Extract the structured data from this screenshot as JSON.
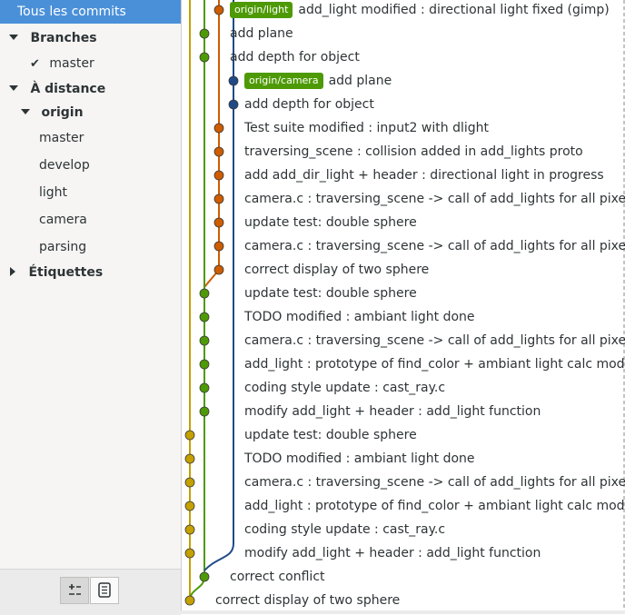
{
  "sidebar": {
    "all_commits": "Tous les commits",
    "branches_header": "Branches",
    "local_branch": "master",
    "remote_header": "À distance",
    "remote_name": "origin",
    "remote_branches": [
      "master",
      "develop",
      "light",
      "camera",
      "parsing"
    ],
    "tags_header": "Étiquettes"
  },
  "footer": {
    "toggle_icon": "branches-toggle-icon",
    "list_icon": "commit-list-icon"
  },
  "colors": {
    "orange": "#ce5c00",
    "green": "#4e9a06",
    "blue": "#204a87",
    "yellow": "#c4a000",
    "tag_bg": "#4e9a06",
    "selection": "#4a90d9"
  },
  "commits": [
    {
      "tag": "origin/light",
      "message": "add_light modified : directional light fixed (gimp)",
      "color": "orange"
    },
    {
      "tag": "",
      "message": "add plane",
      "color": "green"
    },
    {
      "tag": "",
      "message": "add depth for object",
      "color": "green"
    },
    {
      "tag": "origin/camera",
      "message": "add plane",
      "color": "blue"
    },
    {
      "tag": "",
      "message": "add depth for object",
      "color": "blue"
    },
    {
      "tag": "",
      "message": "Test suite modified : input2 with dlight",
      "color": "orange"
    },
    {
      "tag": "",
      "message": "traversing_scene : collision added in add_lights proto",
      "color": "orange"
    },
    {
      "tag": "",
      "message": "add add_dir_light + header : directional light in progress",
      "color": "orange"
    },
    {
      "tag": "",
      "message": "camera.c : traversing_scene -> call of add_lights for all pixels",
      "color": "orange"
    },
    {
      "tag": "",
      "message": "update test: double sphere",
      "color": "orange"
    },
    {
      "tag": "",
      "message": "camera.c : traversing_scene -> call of add_lights for all pixels",
      "color": "orange"
    },
    {
      "tag": "",
      "message": "correct display of two sphere",
      "color": "orange"
    },
    {
      "tag": "",
      "message": "update test: double sphere",
      "color": "green"
    },
    {
      "tag": "",
      "message": "TODO modified : ambiant light done",
      "color": "green"
    },
    {
      "tag": "",
      "message": "camera.c : traversing_scene -> call of add_lights for all pixels",
      "color": "green"
    },
    {
      "tag": "",
      "message": "add_light : prototype of find_color + ambiant light calc modified",
      "color": "green"
    },
    {
      "tag": "",
      "message": "coding style update : cast_ray.c",
      "color": "green"
    },
    {
      "tag": "",
      "message": "modify add_light + header : add_light function",
      "color": "green"
    },
    {
      "tag": "",
      "message": "update test: double sphere",
      "color": "yellow"
    },
    {
      "tag": "",
      "message": "TODO modified : ambiant light done",
      "color": "yellow"
    },
    {
      "tag": "",
      "message": "camera.c : traversing_scene -> call of add_lights for all pixels",
      "color": "yellow"
    },
    {
      "tag": "",
      "message": "add_light : prototype of find_color + ambiant light calc modified",
      "color": "yellow"
    },
    {
      "tag": "",
      "message": "coding style update : cast_ray.c",
      "color": "yellow"
    },
    {
      "tag": "",
      "message": "modify add_light + header : add_light function",
      "color": "yellow"
    },
    {
      "tag": "",
      "message": "correct conflict",
      "color": "green"
    },
    {
      "tag": "",
      "message": "correct display of two sphere",
      "color": "yellow"
    }
  ]
}
